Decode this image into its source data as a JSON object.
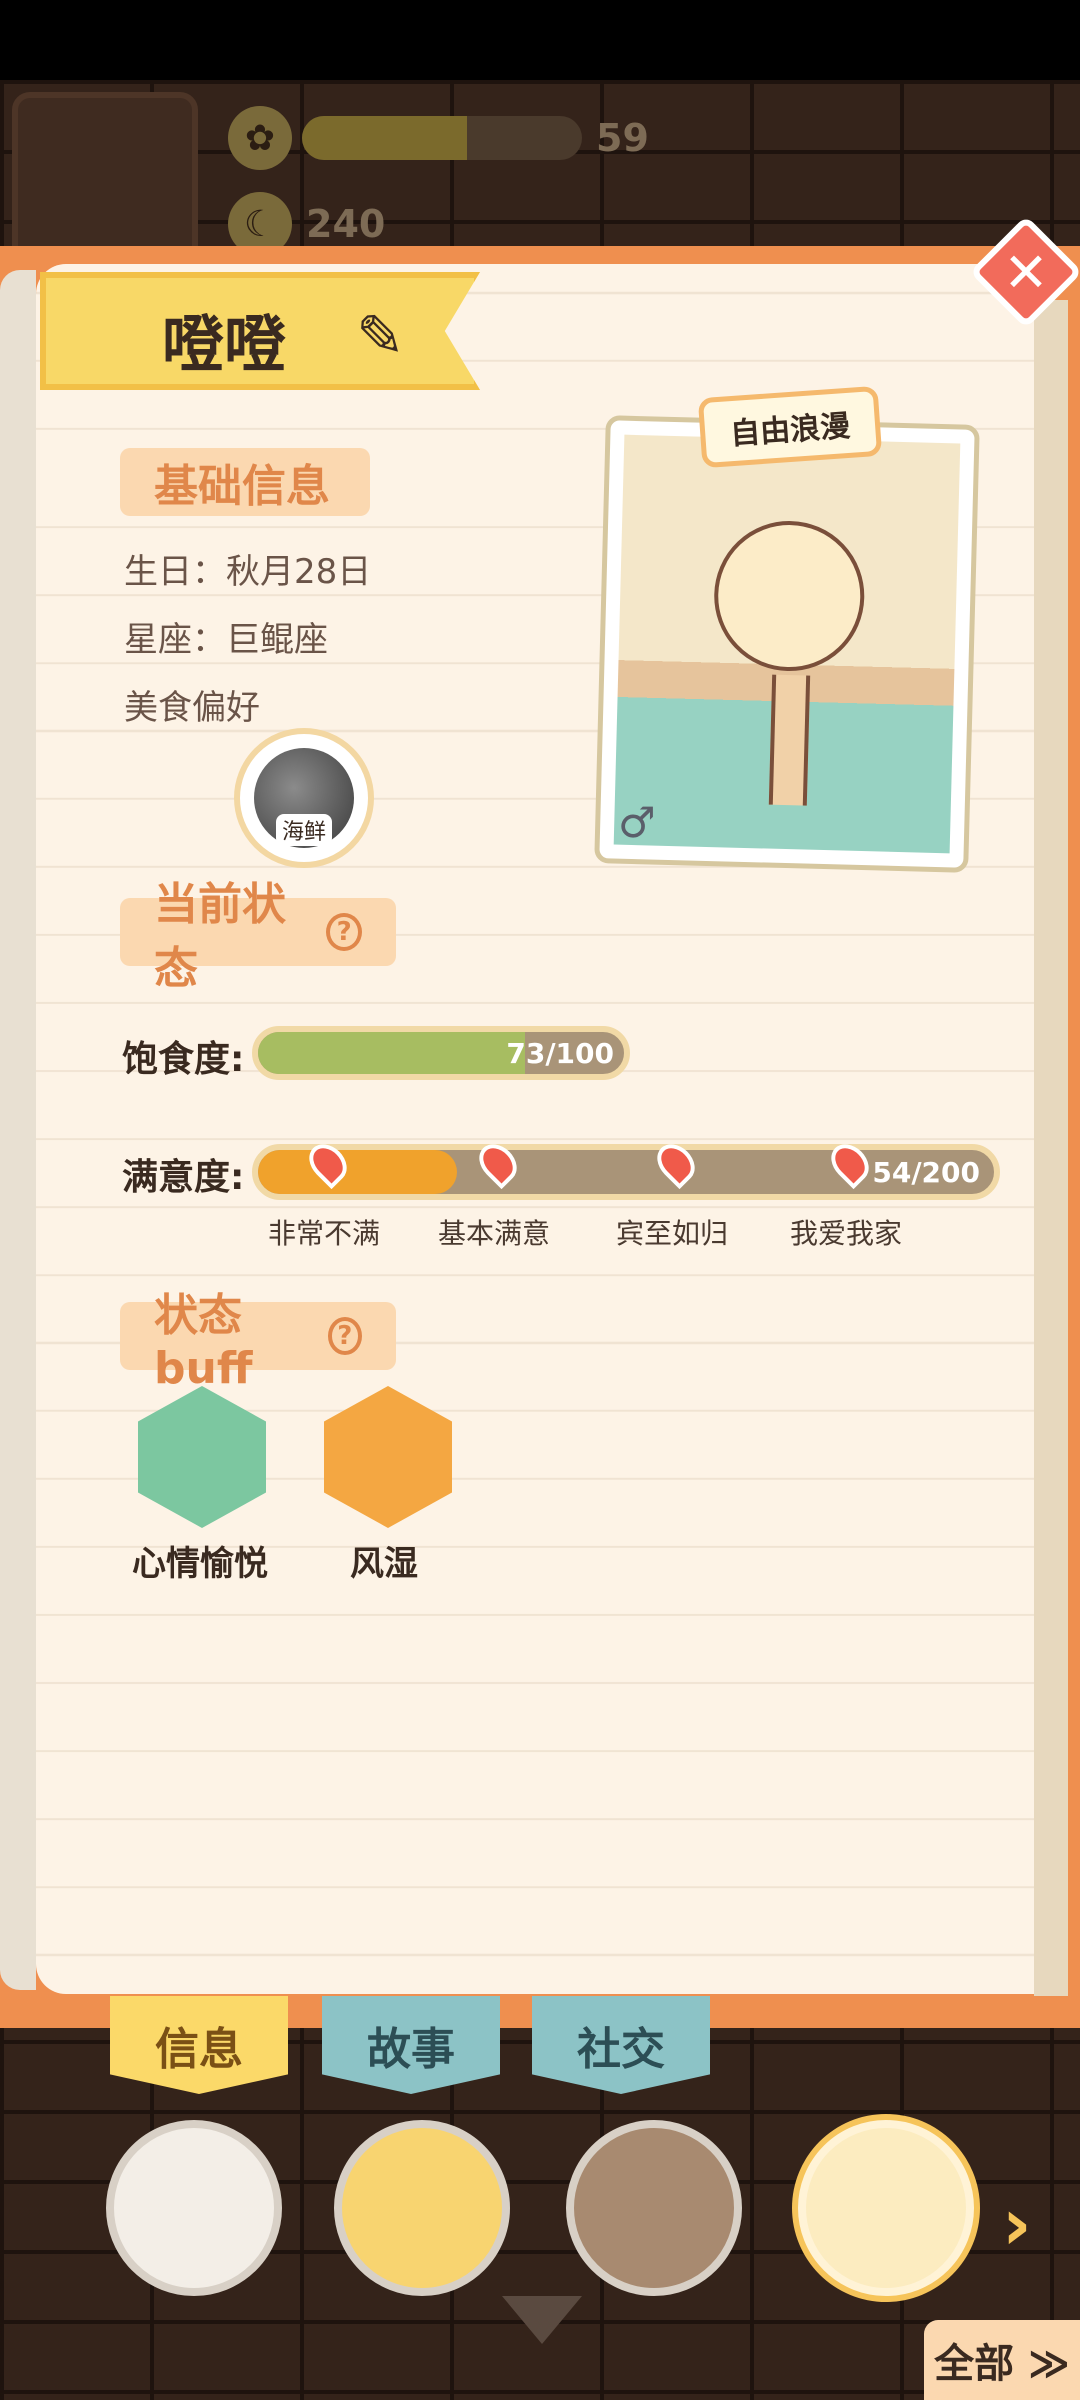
{
  "resources": [
    {
      "icon": "flower-icon",
      "value": "59",
      "fill_percent": 59
    },
    {
      "icon": "banana-icon",
      "value": "240"
    }
  ],
  "character": {
    "name": "噔噔",
    "tag": "自由浪漫",
    "gender_symbol": "♂"
  },
  "basic_info": {
    "title": "基础信息",
    "birthday": "生日：秋月28日",
    "constellation": "星座：巨鲲座",
    "food_pref_label": "美食偏好",
    "food_pref": "海鲜"
  },
  "status": {
    "title": "当前状态",
    "help": "?",
    "hunger_label": "饱食度:",
    "hunger_value": "73/100",
    "hunger_fraction": 0.73,
    "satisfaction_label": "满意度:",
    "satisfaction_value": "54/200",
    "satisfaction_fraction": 0.27,
    "milestones": [
      "非常不满",
      "基本满意",
      "宾至如归",
      "我爱我家"
    ]
  },
  "buffs": {
    "title": "状态buff",
    "help": "?",
    "items": [
      {
        "label": "心情愉悦",
        "color": "#7cc7a0"
      },
      {
        "label": "风湿",
        "color": "#f4a742"
      }
    ]
  },
  "tabs": [
    "信息",
    "故事",
    "社交"
  ],
  "close_symbol": "✕",
  "all_button": "全部 ≫",
  "colors": {
    "accent_orange": "#ef8f4f",
    "paper": "#fdf3e6",
    "hunger_green": "#a7bd61",
    "satisfaction_orange": "#f0a22c"
  }
}
